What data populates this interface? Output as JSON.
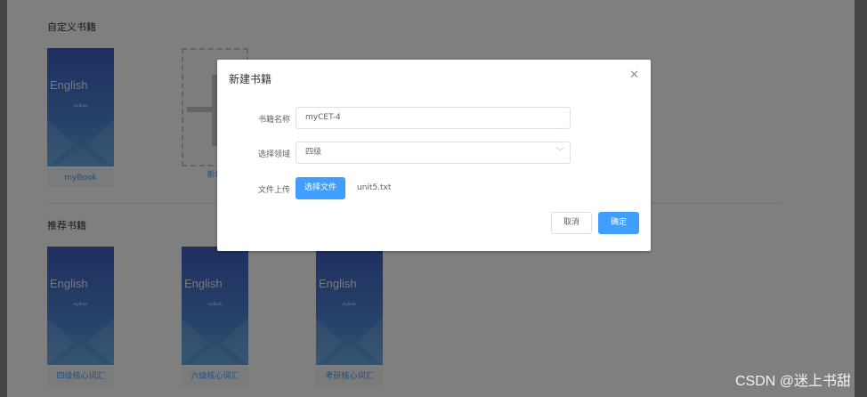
{
  "sections": {
    "custom_title": "自定义书籍",
    "recommended_title": "推荐书籍"
  },
  "custom_books": [
    {
      "cover_title": "English",
      "cover_subtitle": "myBook",
      "label": "myBook"
    }
  ],
  "add_book": {
    "label": "新增"
  },
  "recommended_books": [
    {
      "cover_title": "English",
      "cover_subtitle": "myBook",
      "label": "四级核心词汇"
    },
    {
      "cover_title": "English",
      "cover_subtitle": "myBook",
      "label": "六级核心词汇"
    },
    {
      "cover_title": "English",
      "cover_subtitle": "myBook",
      "label": "考研核心词汇"
    }
  ],
  "dialog": {
    "title": "新建书籍",
    "close_icon": "close-icon",
    "fields": {
      "name_label": "书籍名称",
      "name_value": "myCET-4",
      "domain_label": "选择领域",
      "domain_value": "四级",
      "upload_label": "文件上传",
      "upload_button": "选择文件",
      "file_name": "unit5.txt"
    },
    "cancel_button": "取消",
    "confirm_button": "确定"
  },
  "watermark": "CSDN @迷上书甜",
  "colors": {
    "primary": "#409eff",
    "overlay": "rgba(0,0,0,0.5)"
  }
}
